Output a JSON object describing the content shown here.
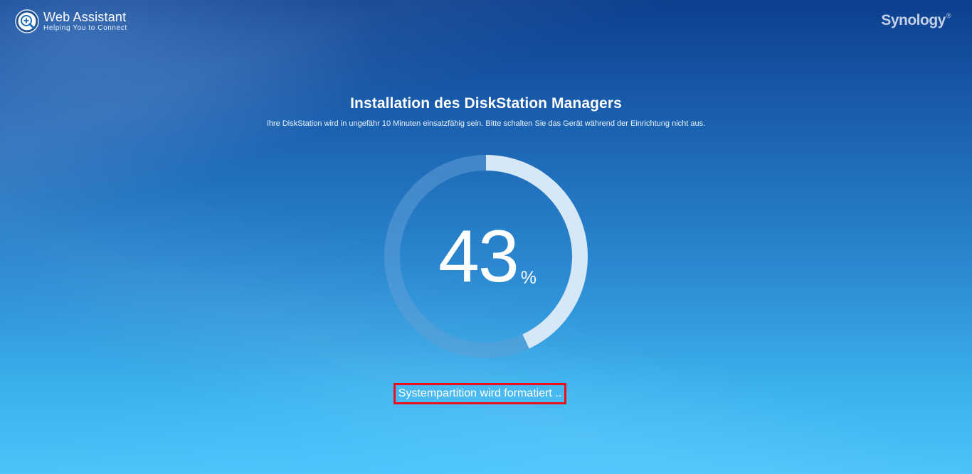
{
  "header": {
    "app_title": "Web Assistant",
    "app_subtitle": "Helping You to Connect",
    "logo_icon": "magnifier-plus-icon",
    "brand": "Synology",
    "brand_mark": "®"
  },
  "main": {
    "title": "Installation des DiskStation Managers",
    "subtitle": "Ihre DiskStation wird in ungefähr 10 Minuten einsatzfähig sein. Bitte schalten Sie das Gerät während der Einrichtung nicht aus.",
    "progress": {
      "value": 43,
      "value_text": "43",
      "unit": "%"
    },
    "status_text": "Systempartition wird formatiert .."
  },
  "colors": {
    "ring_track": "#5f9fd6",
    "ring_fill": "#d6e8f7",
    "status_border": "#e8101d"
  }
}
